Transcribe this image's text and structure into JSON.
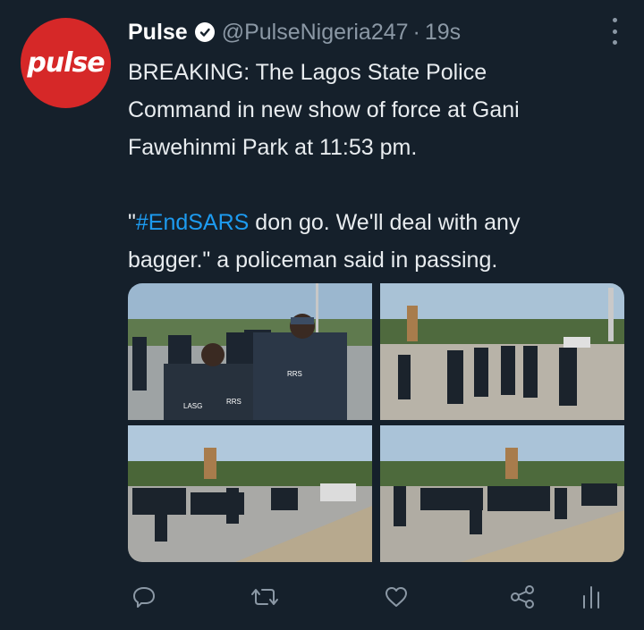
{
  "tweet": {
    "author_name": "Pulse",
    "handle": "@PulseNigeria247",
    "separator": "·",
    "time": "19s",
    "avatar_text": "pulse",
    "text_line1": "BREAKING: The Lagos State Police Command in new show of force at Gani Fawehinmi Park at 11:53 pm.",
    "text_q_open": "\"",
    "hashtag": "#EndSARS",
    "text_line2_rest": " don go. We'll deal with any bagger.\" a policeman said in passing."
  },
  "photos": {
    "vest_labels": [
      "RRS",
      "RRS",
      "LASG"
    ]
  },
  "actions": [
    {
      "name": "reply",
      "icon": "reply-icon"
    },
    {
      "name": "retweet",
      "icon": "retweet-icon"
    },
    {
      "name": "like",
      "icon": "heart-icon"
    },
    {
      "name": "share",
      "icon": "share-icon"
    },
    {
      "name": "analytics",
      "icon": "analytics-icon"
    }
  ],
  "colors": {
    "background": "#15202b",
    "hashtag": "#1d9bf0",
    "muted": "#8b98a5",
    "avatar": "#d62828"
  }
}
